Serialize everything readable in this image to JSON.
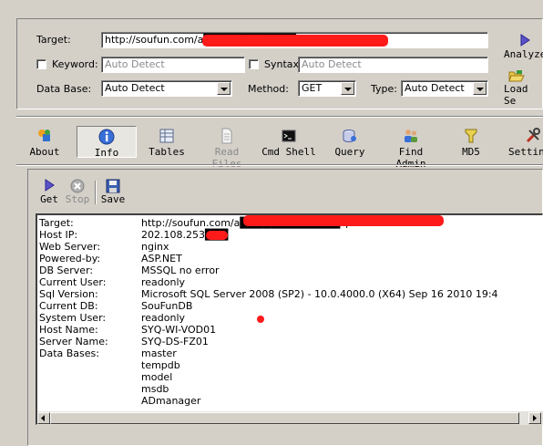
{
  "form": {
    "target_label": "Target:",
    "target_value": "http://soufun.com/a████████████.asp?id=664477",
    "keyword_label": "Keyword:",
    "keyword_placeholder": "Auto Detect",
    "syntax_label": "Syntax:",
    "syntax_placeholder": "Auto Detect",
    "database_label": "Data Base:",
    "database_value": "Auto Detect",
    "method_label": "Method:",
    "method_value": "GET",
    "type_label": "Type:",
    "type_value": "Auto Detect"
  },
  "side_buttons": {
    "analyze_label": "Analyze",
    "load_label": "Load Se"
  },
  "toolbar": [
    {
      "label": "About",
      "icon": "about-icon",
      "disabled": false
    },
    {
      "label": "Info",
      "icon": "info-icon",
      "disabled": false,
      "pressed": true
    },
    {
      "label": "Tables",
      "icon": "tables-icon",
      "disabled": false
    },
    {
      "label": "Read Files",
      "icon": "read-files-icon",
      "disabled": true
    },
    {
      "label": "Cmd Shell",
      "icon": "cmd-shell-icon",
      "disabled": false
    },
    {
      "label": "Query",
      "icon": "query-icon",
      "disabled": false
    },
    {
      "label": "Find Admin",
      "icon": "find-admin-icon",
      "disabled": false
    },
    {
      "label": "MD5",
      "icon": "md5-icon",
      "disabled": false
    },
    {
      "label": "Settin",
      "icon": "settings-icon",
      "disabled": false
    }
  ],
  "subtoolbar": {
    "get_label": "Get",
    "stop_label": "Stop",
    "save_label": "Save"
  },
  "results": {
    "rows": [
      {
        "key": "Target:",
        "value": "http://soufun.com/a█████████████sp?id=664477"
      },
      {
        "key": "Host IP:",
        "value": "202.108.253███"
      },
      {
        "key": "Web Server:",
        "value": "nginx"
      },
      {
        "key": "Powered-by:",
        "value": "ASP.NET"
      },
      {
        "key": "DB Server:",
        "value": "MSSQL no error"
      },
      {
        "key": "Current User:",
        "value": "readonly"
      },
      {
        "key": "Sql Version:",
        "value": "Microsoft SQL Server 2008 (SP2) - 10.0.4000.0 (X64)       Sep 16 2010 19:4"
      },
      {
        "key": "Current DB:",
        "value": "SouFunDB"
      },
      {
        "key": "System User:",
        "value": "readonly"
      },
      {
        "key": "Host Name:",
        "value": "SYQ-WI-VOD01"
      },
      {
        "key": "Server Name:",
        "value": "SYQ-DS-FZ01"
      },
      {
        "key": "Data Bases:",
        "value": "master"
      },
      {
        "key": "",
        "value": "tempdb"
      },
      {
        "key": "",
        "value": "model"
      },
      {
        "key": "",
        "value": "msdb"
      },
      {
        "key": "",
        "value": "ADmanager"
      }
    ]
  },
  "colors": {
    "window_bg": "#d4d0c8",
    "redaction": "#ff1a1a",
    "disabled_text": "#8a8a8a"
  }
}
